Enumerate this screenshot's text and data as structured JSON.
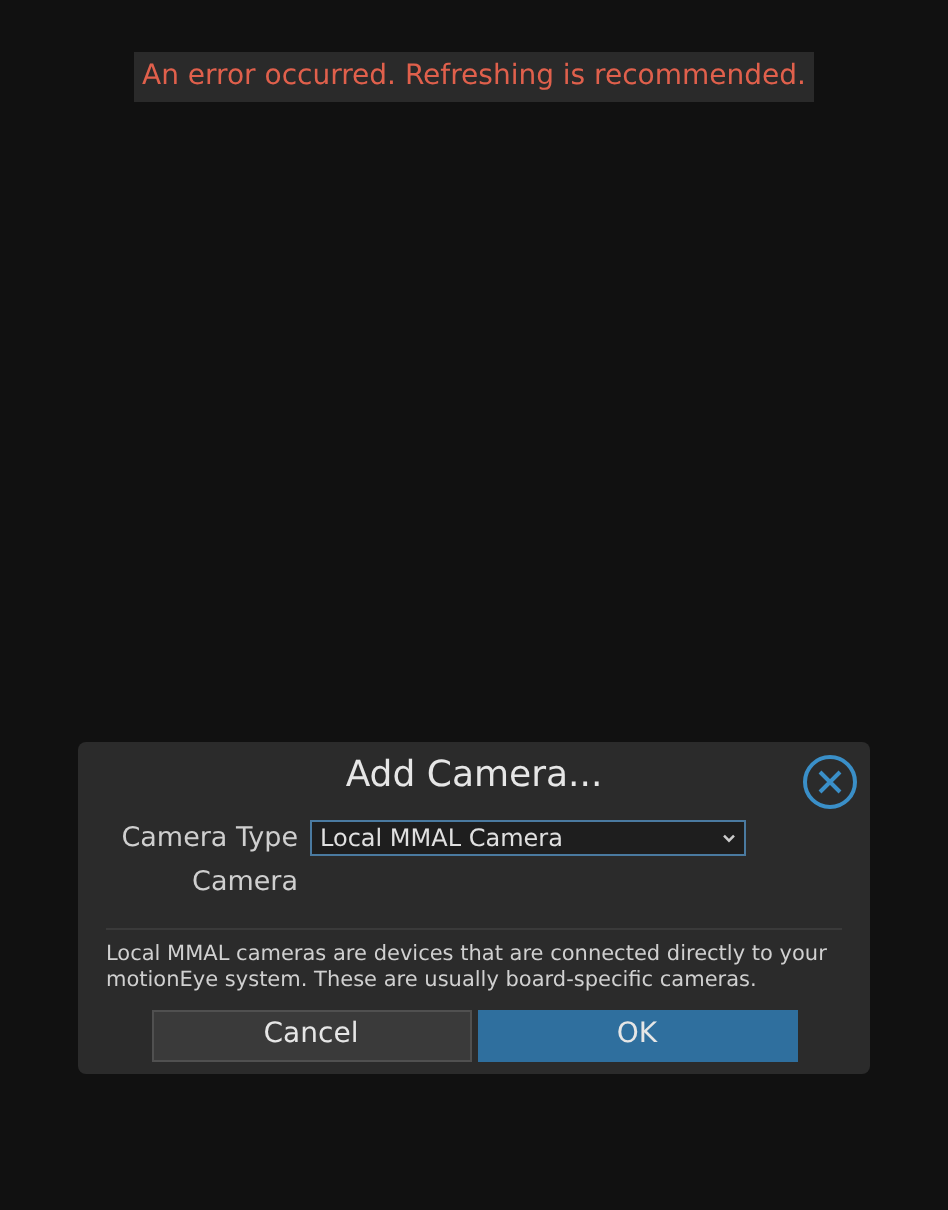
{
  "error_message": "An error occurred. Refreshing is recommended.",
  "dialog": {
    "title": "Add Camera...",
    "fields": [
      {
        "label": "Camera Type",
        "value": "Local MMAL Camera"
      },
      {
        "label": "Camera"
      }
    ],
    "description": "Local MMAL cameras are devices that are connected directly to your motionEye system. These are usually board-specific cameras.",
    "buttons": [
      {
        "label": "Cancel",
        "kind": "secondary"
      },
      {
        "label": "OK",
        "kind": "primary"
      }
    ]
  }
}
